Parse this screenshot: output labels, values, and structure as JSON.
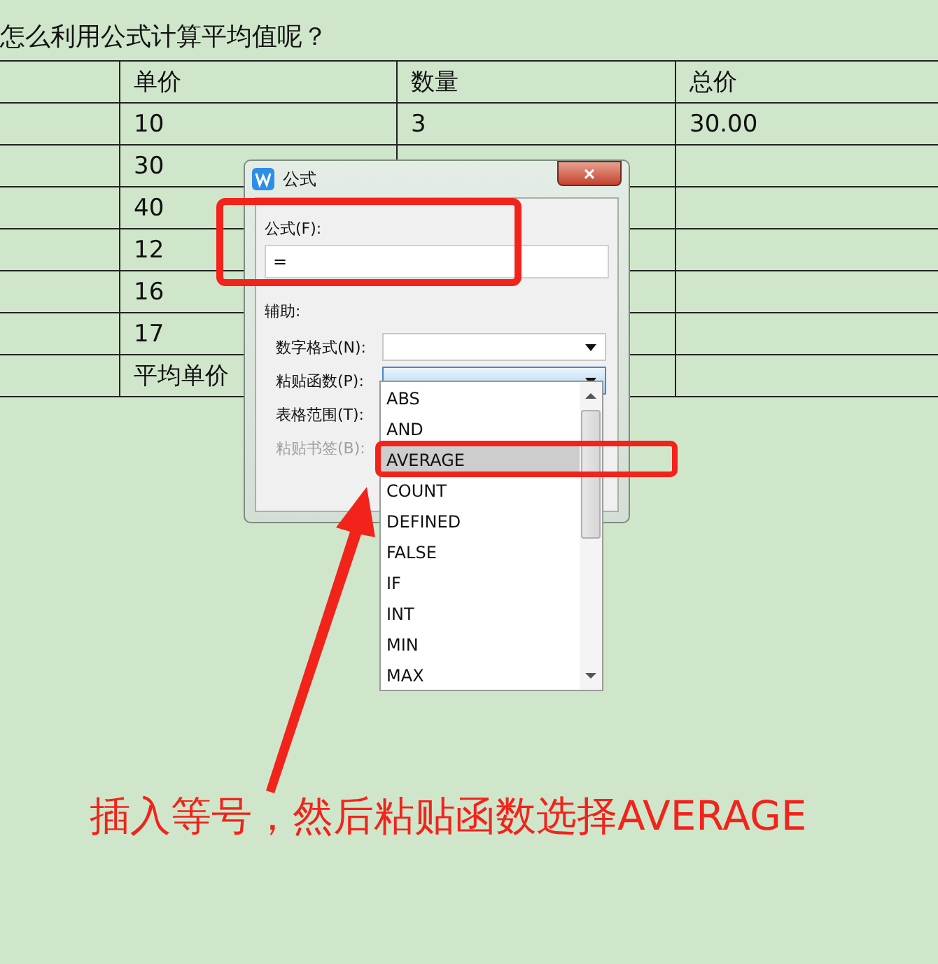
{
  "document": {
    "question": "怎么利用公式计算平均值呢？",
    "table": {
      "columns": [
        "单价",
        "数量",
        "总价"
      ],
      "rows": [
        {
          "unit_price": "10",
          "quantity": "3",
          "total": "30.00"
        },
        {
          "unit_price": "30"
        },
        {
          "unit_price": "40"
        },
        {
          "unit_price": "12"
        },
        {
          "unit_price": "16"
        },
        {
          "unit_price": "17"
        },
        {
          "unit_price": "平均单价"
        }
      ]
    }
  },
  "dialog": {
    "title": "公式",
    "close_symbol": "×",
    "formula": {
      "label": "公式(F):",
      "value": "="
    },
    "section": "辅助:",
    "fields": [
      {
        "label": "数字格式(N):",
        "kind": "select",
        "focused": false,
        "disabled": false
      },
      {
        "label": "粘贴函数(P):",
        "kind": "select",
        "focused": true,
        "disabled": false
      },
      {
        "label": "表格范围(T):",
        "kind": "plain",
        "disabled": false
      },
      {
        "label": "粘贴书签(B):",
        "kind": "plain",
        "disabled": true
      }
    ],
    "function_list": [
      {
        "label": "ABS",
        "selected": false
      },
      {
        "label": "AND",
        "selected": false
      },
      {
        "label": "AVERAGE",
        "selected": true
      },
      {
        "label": "COUNT",
        "selected": false
      },
      {
        "label": "DEFINED",
        "selected": false
      },
      {
        "label": "FALSE",
        "selected": false
      },
      {
        "label": "IF",
        "selected": false
      },
      {
        "label": "INT",
        "selected": false
      },
      {
        "label": "MIN",
        "selected": false
      },
      {
        "label": "MAX",
        "selected": false
      }
    ]
  },
  "annotation": {
    "caption": "插入等号，然后粘贴函数选择AVERAGE"
  }
}
